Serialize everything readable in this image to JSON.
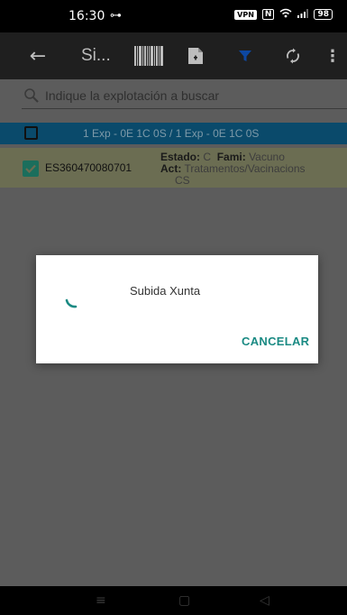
{
  "status_bar": {
    "time": "16:30",
    "key_glyph": "⊶",
    "vpn": "VPN",
    "nfc": "N",
    "battery": "98"
  },
  "toolbar": {
    "back_glyph": "←",
    "title": "Si...",
    "sync_glyph": "⇄",
    "menu_glyph": "⋮"
  },
  "search": {
    "placeholder": "Indique la explotación a buscar",
    "value": ""
  },
  "list_header": {
    "summary": "1 Exp - 0E 1C 0S / 1 Exp - 0E 1C 0S"
  },
  "items": [
    {
      "code": "ES360470080701",
      "estado_label": "Estado:",
      "estado_value": "C",
      "fami_label": "Fami:",
      "fami_value": "Vacuno",
      "act_label": "Act:",
      "act_value": "Tratamentos/Vacinacions",
      "act_value_2": "CS",
      "checked": true
    }
  ],
  "dialog": {
    "message": "Subida Xunta",
    "cancel_label": "CANCELAR"
  },
  "nav": {
    "menu_glyph": "≡",
    "home_glyph": "▢",
    "back_glyph": "◁"
  },
  "colors": {
    "accent": "#1a8a83",
    "header_row": "#0a4a6b",
    "selected_row": "#6b6d52",
    "filter_icon": "#0d47a1"
  }
}
